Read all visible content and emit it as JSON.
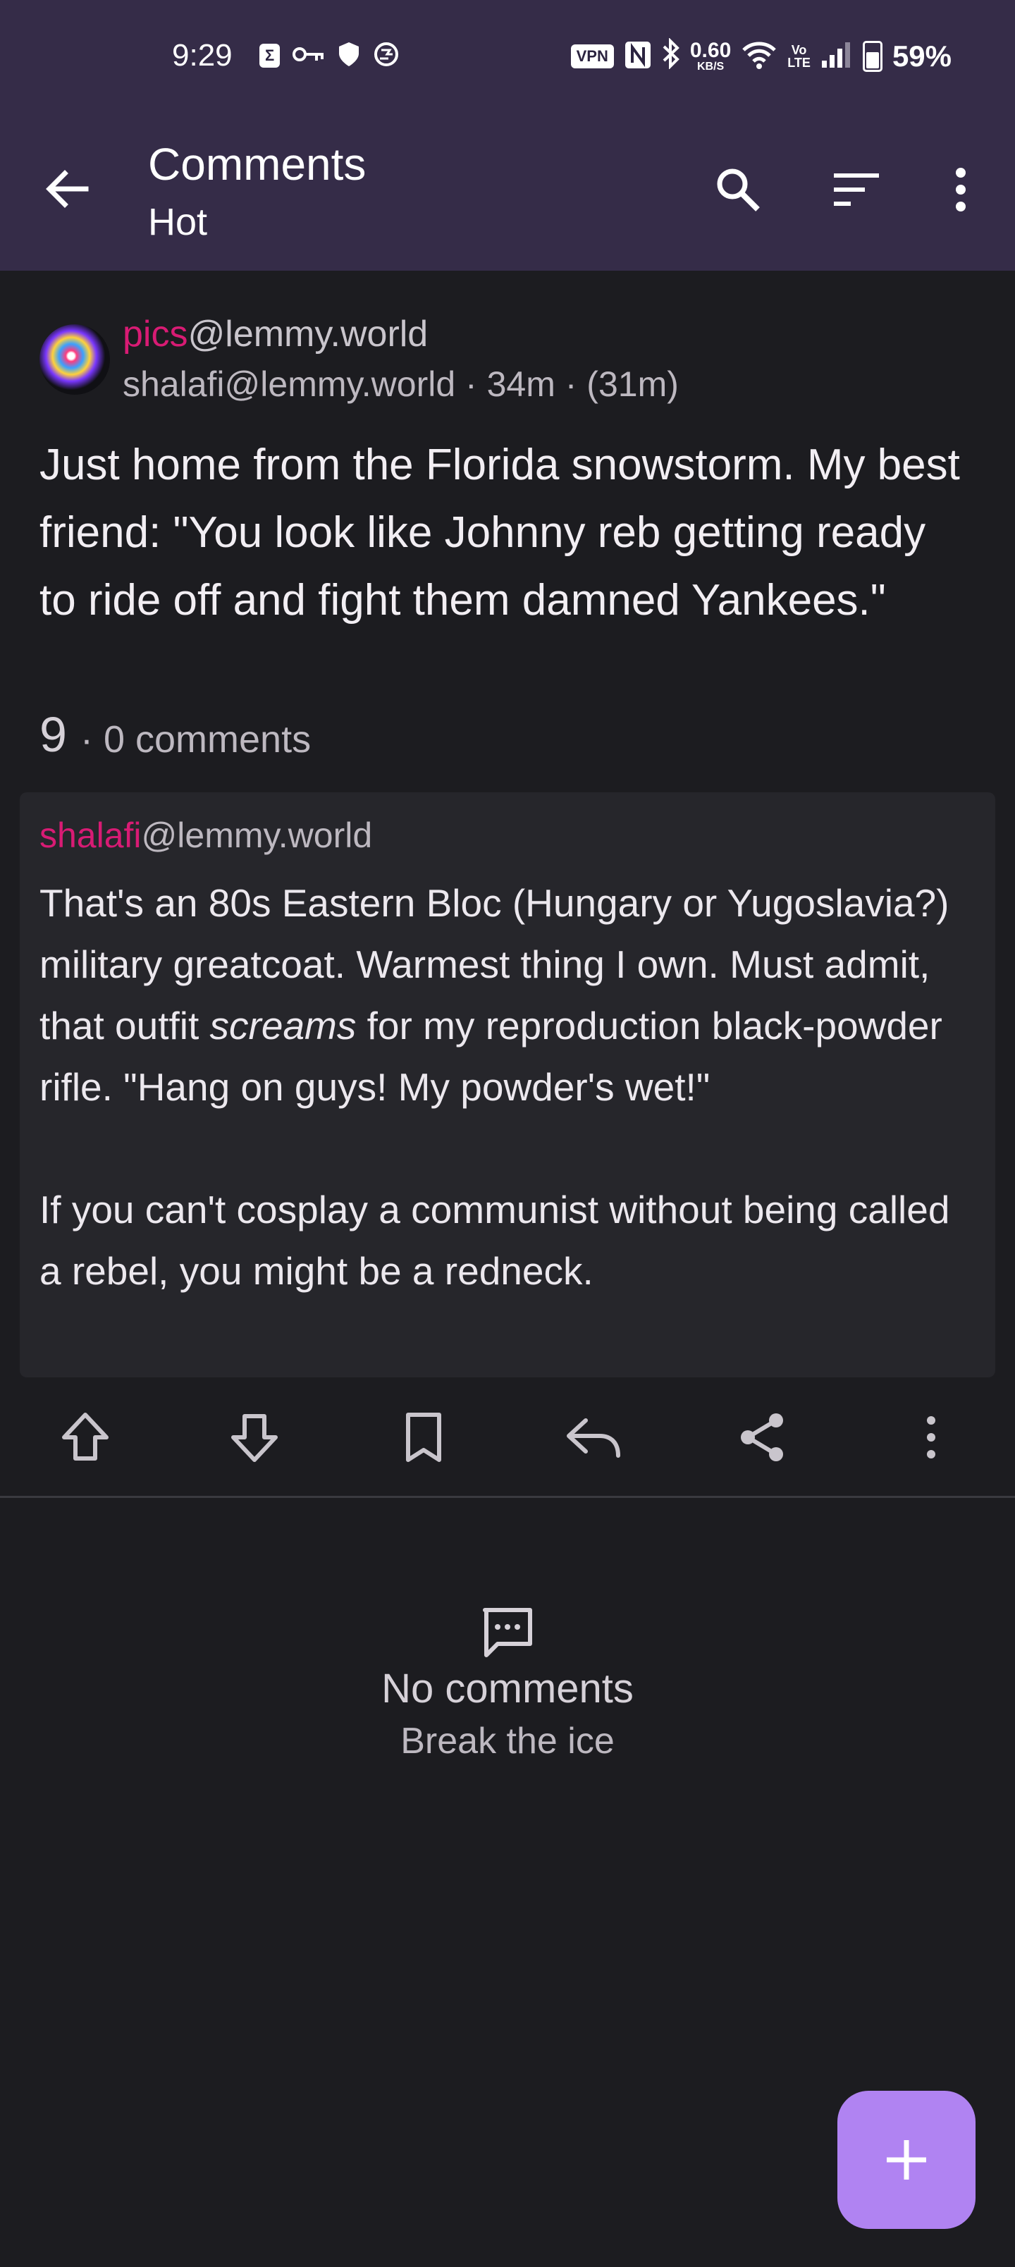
{
  "status_bar": {
    "time": "9:29",
    "vpn_label": "VPN",
    "speed_value": "0.60",
    "speed_unit": "KB/S",
    "battery_percent": "59%",
    "battery_level": 0.59
  },
  "app_bar": {
    "title": "Comments",
    "subtitle": "Hot"
  },
  "post": {
    "community": "pics",
    "instance": "@lemmy.world",
    "author_line": "shalafi@lemmy.world · 34m · (31m)",
    "title": "Just home from the Florida snowstorm.  My best friend: \"You look like Johnny reb getting ready to ride off and fight them damned Yankees.\"",
    "score": "9",
    "comments_text": "· 0 comments"
  },
  "body": {
    "author_name": "shalafi",
    "author_instance": "@lemmy.world",
    "paragraph1_part1": "That's an 80s Eastern Bloc (Hungary or Yugoslavia?) military greatcoat.  Warmest thing I own.  Must admit, that outfit ",
    "paragraph1_emphasis": "screams",
    "paragraph1_part2": " for my reproduction black-powder rifle.  \"Hang on guys!  My powder's wet!\"",
    "paragraph2": "If you can't cosplay a communist without being called a rebel, you might be a redneck."
  },
  "empty_state": {
    "title": "No comments",
    "subtitle": "Break the ice"
  },
  "colors": {
    "top_bar": "#352c48",
    "background": "#1c1c20",
    "card": "#26262b",
    "accent_pink": "#d81b74",
    "fab": "#b083f2"
  }
}
